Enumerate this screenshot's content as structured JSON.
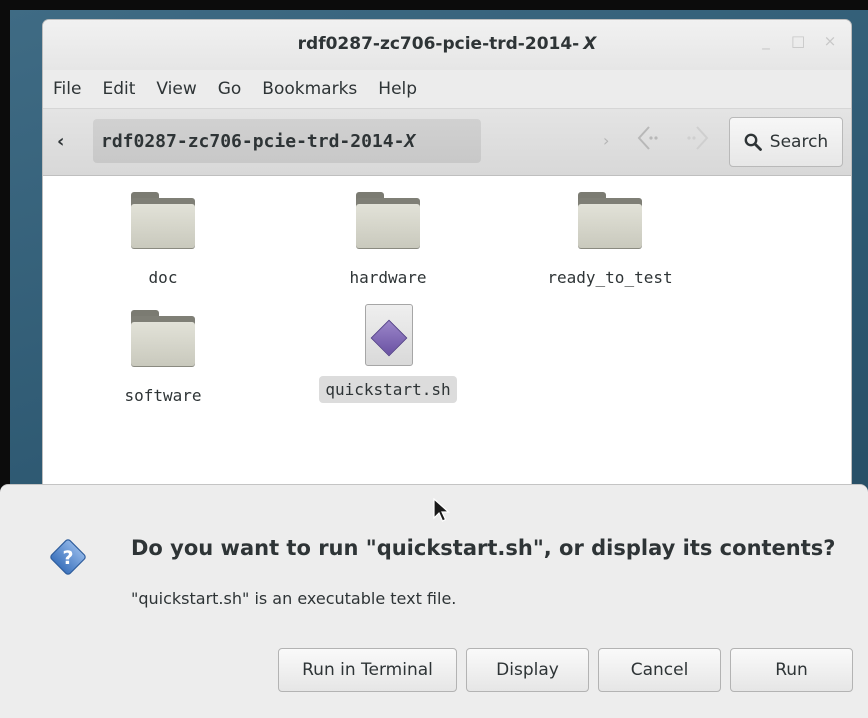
{
  "window": {
    "title": "rdf0287-zc706-pcie-trd-2014-",
    "title_x": "X",
    "controls": [
      "_",
      "□",
      "×"
    ]
  },
  "menubar": [
    "File",
    "Edit",
    "View",
    "Go",
    "Bookmarks",
    "Help"
  ],
  "toolbar": {
    "back_icon": "‹",
    "path": "rdf0287-zc706-pcie-trd-2014-",
    "path_x": "X",
    "forward_icon": "›",
    "search_label": "Search"
  },
  "files": [
    {
      "name": "doc",
      "type": "folder"
    },
    {
      "name": "hardware",
      "type": "folder"
    },
    {
      "name": "ready_to_test",
      "type": "folder"
    },
    {
      "name": "software",
      "type": "folder"
    },
    {
      "name": "quickstart.sh",
      "type": "script",
      "selected": true
    }
  ],
  "dialog": {
    "title": "Do you want to run \"quickstart.sh\", or display its contents?",
    "subtitle": "\"quickstart.sh\" is an executable text file.",
    "buttons": [
      "Run in Terminal",
      "Display",
      "Cancel",
      "Run"
    ]
  },
  "colors": {
    "desktop": "#2c5770",
    "dialog_icon": "#4a7fc4",
    "script_diamond": "#7b63b4"
  }
}
